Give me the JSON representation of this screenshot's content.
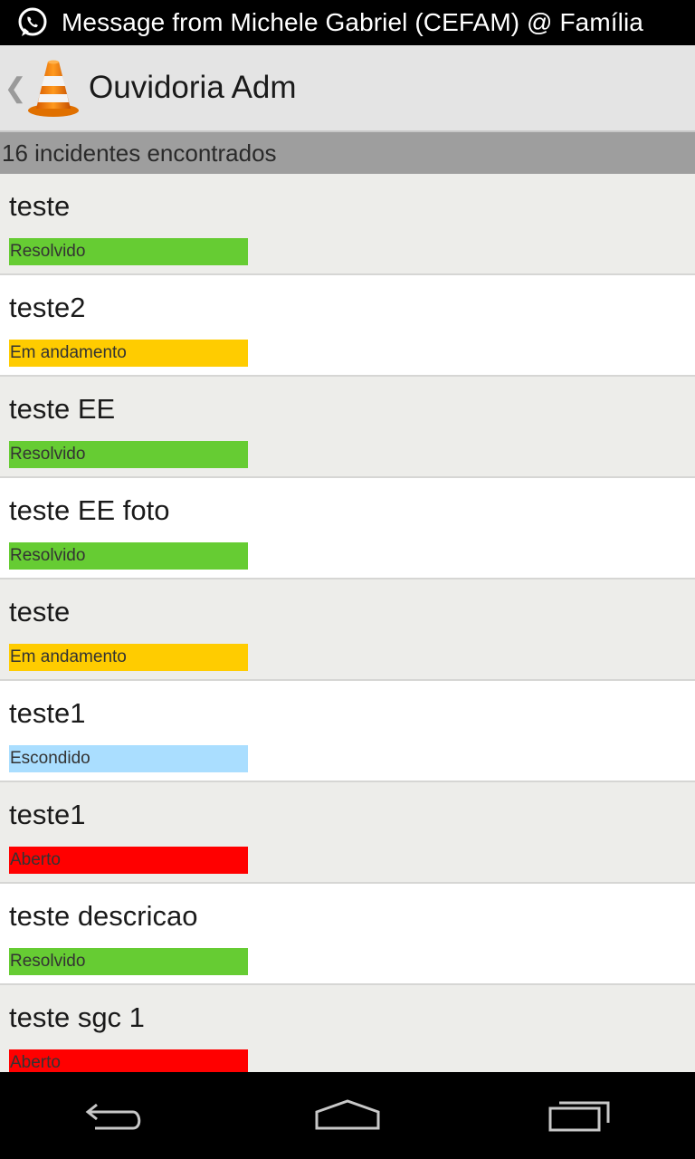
{
  "notification": {
    "icon": "whatsapp-icon",
    "text": "Message from Michele Gabriel (CEFAM) @ Família"
  },
  "actionbar": {
    "up_icon": "chevron-left-icon",
    "logo_icon": "traffic-cone-icon",
    "title": "Ouvidoria Adm"
  },
  "list_header": {
    "count_text": "16 incidentes encontrados"
  },
  "status_colors": {
    "Resolvido": "#66cc33",
    "Em andamento": "#ffcc00",
    "Escondido": "#aadeff",
    "Aberto": "#ff0000"
  },
  "incidents": [
    {
      "title": "teste",
      "status": "Resolvido"
    },
    {
      "title": "teste2",
      "status": "Em andamento"
    },
    {
      "title": "teste EE",
      "status": "Resolvido"
    },
    {
      "title": "teste EE foto",
      "status": "Resolvido"
    },
    {
      "title": "teste",
      "status": "Em andamento"
    },
    {
      "title": "teste1",
      "status": "Escondido"
    },
    {
      "title": "teste1",
      "status": "Aberto"
    },
    {
      "title": "teste descricao",
      "status": "Resolvido"
    },
    {
      "title": "teste sgc 1",
      "status": "Aberto"
    }
  ],
  "navbar": {
    "back_icon": "back-arrow-icon",
    "home_icon": "home-icon",
    "recents_icon": "recent-apps-icon"
  }
}
